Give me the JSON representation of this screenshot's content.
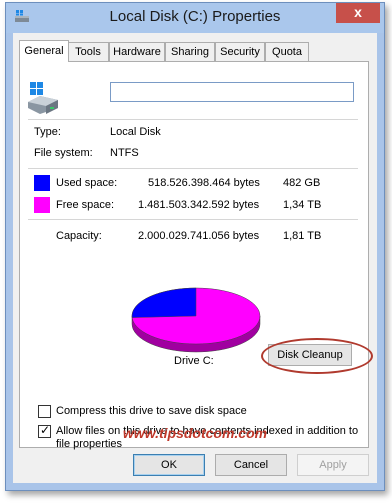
{
  "window": {
    "title": "Local Disk (C:) Properties",
    "close_glyph": "x"
  },
  "tabs": [
    {
      "label": "General",
      "active": true
    },
    {
      "label": "Tools"
    },
    {
      "label": "Hardware"
    },
    {
      "label": "Sharing"
    },
    {
      "label": "Security"
    },
    {
      "label": "Quota"
    }
  ],
  "drive_name_value": "",
  "type": {
    "label": "Type:",
    "value": "Local Disk"
  },
  "file_system": {
    "label": "File system:",
    "value": "NTFS"
  },
  "used": {
    "label": "Used space:",
    "bytes": "518.526.398.464 bytes",
    "size": "482 GB",
    "color": "#0000ff"
  },
  "free": {
    "label": "Free space:",
    "bytes": "1.481.503.342.592 bytes",
    "size": "1,34 TB",
    "color": "#ff00ff"
  },
  "capacity": {
    "label": "Capacity:",
    "bytes": "2.000.029.741.056 bytes",
    "size": "1,81 TB"
  },
  "drive_label": "Drive C:",
  "disk_cleanup_label": "Disk Cleanup",
  "compress": {
    "label": "Compress this drive to save disk space",
    "checked": false
  },
  "index": {
    "line1": "Allow files on this drive to have contents indexed in addition to",
    "line2": "file properties",
    "checked": true
  },
  "watermark": "www.tipsdotcom.com",
  "buttons": {
    "ok": "OK",
    "cancel": "Cancel",
    "apply": "Apply"
  },
  "used_fraction": 0.259
}
